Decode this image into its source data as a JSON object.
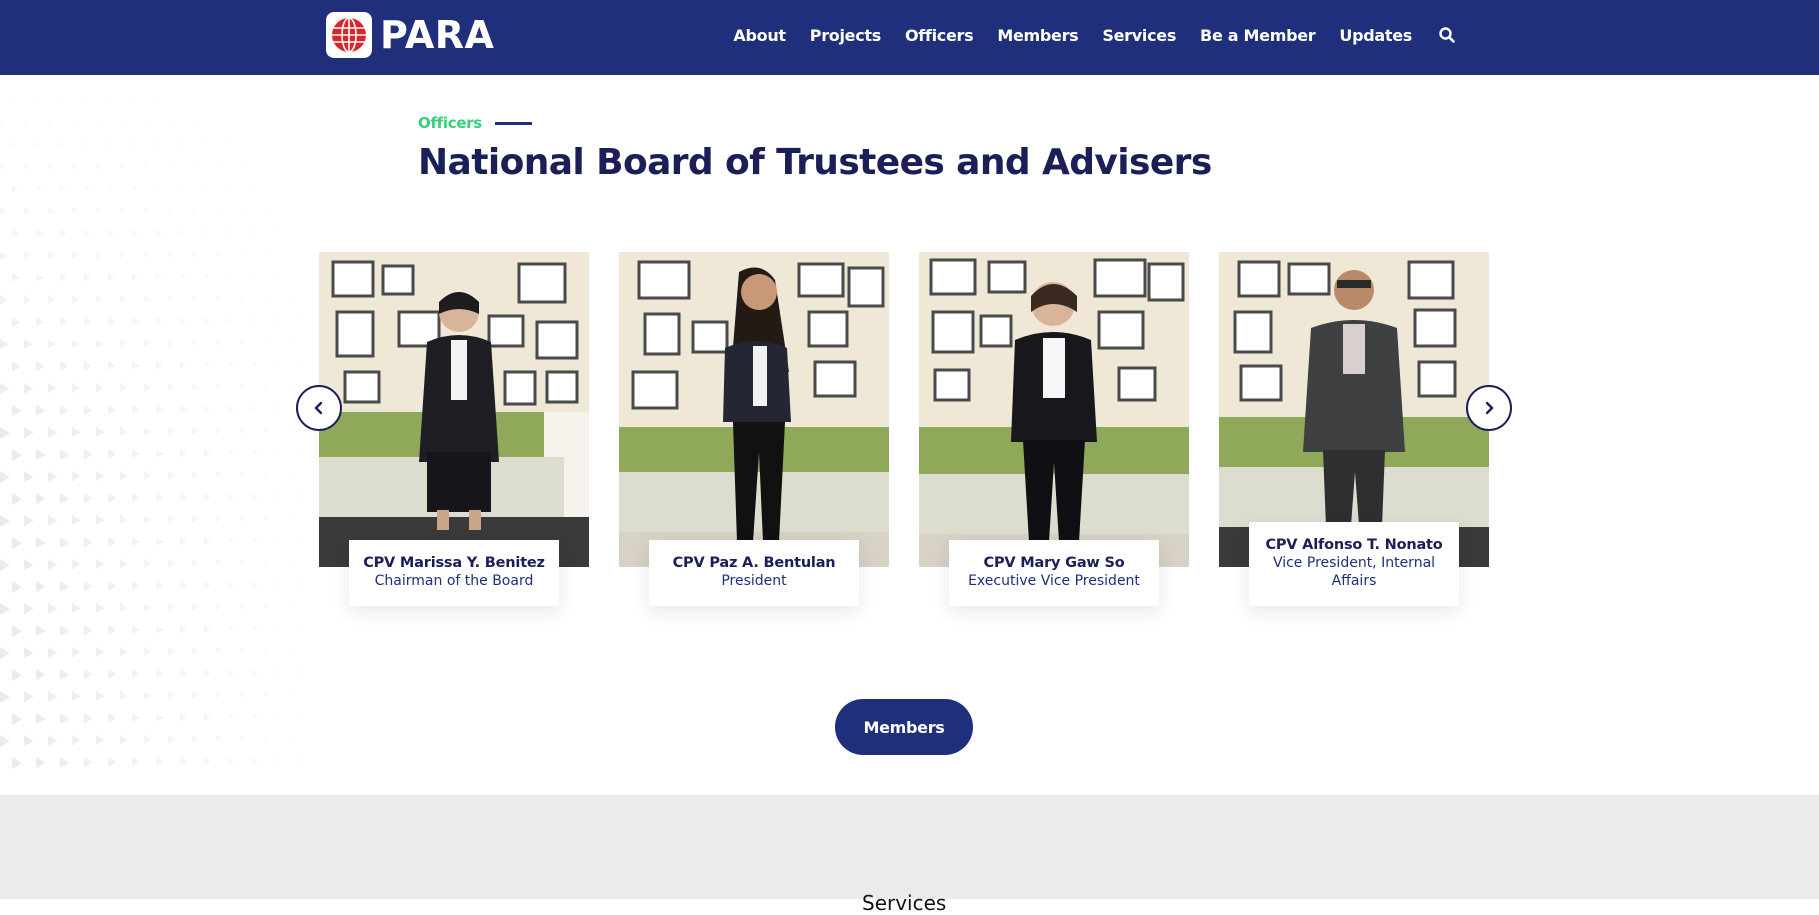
{
  "brand": {
    "name": "PARA",
    "accent": "#1f2f7b",
    "highlight": "#34d07b",
    "logo_color": "#d9262b"
  },
  "nav": {
    "items": [
      {
        "label": "About"
      },
      {
        "label": "Projects"
      },
      {
        "label": "Officers"
      },
      {
        "label": "Members"
      },
      {
        "label": "Services"
      },
      {
        "label": "Be a Member"
      },
      {
        "label": "Updates"
      }
    ],
    "search_icon": "search-icon"
  },
  "section": {
    "eyebrow": "Officers",
    "title": "National Board of Trustees and Advisers"
  },
  "officers": [
    {
      "name": "CPV Marissa Y. Benitez",
      "role": "Chairman of the Board"
    },
    {
      "name": "CPV Paz A. Bentulan",
      "role": "President"
    },
    {
      "name": "CPV Mary Gaw So",
      "role": "Executive Vice President"
    },
    {
      "name": "CPV Alfonso T. Nonato",
      "role": "Vice President, Internal Affairs"
    }
  ],
  "carousel": {
    "prev_icon": "chevron-left-icon",
    "next_icon": "chevron-right-icon"
  },
  "members_button": {
    "label": "Members"
  },
  "next_section": {
    "partial_heading": "Services"
  }
}
